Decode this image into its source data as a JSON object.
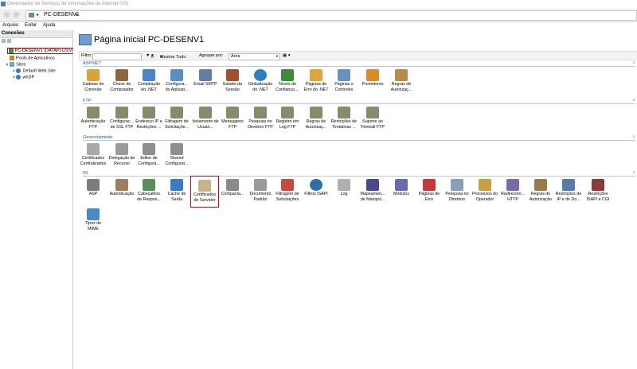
{
  "window": {
    "title": "Gerenciador de Serviços de Informações da Internet (IIS)"
  },
  "address": {
    "breadcrumb": "PC-DESENV1"
  },
  "menu": [
    "Arquivo",
    "Exibir",
    "Ajuda"
  ],
  "connections": {
    "header": "Conexões",
    "tree": [
      {
        "label": "PC-DESENV1 (DATAPLUS\\Vin",
        "level": 0,
        "selected": true
      },
      {
        "label": "Pools de Aplicativos",
        "level": 1
      },
      {
        "label": "Sites",
        "level": 1
      },
      {
        "label": "Default Web Site",
        "level": 2
      },
      {
        "label": "whDP",
        "level": 2
      }
    ]
  },
  "main": {
    "title": "Página inicial PC-DESENV1",
    "filter": {
      "label": "Filtro:",
      "go": "Ir",
      "show_all": "Mostrar Tudo",
      "group_label": "Agrupar por:",
      "group_value": "Área"
    },
    "sections": [
      {
        "name": "ASP.NET",
        "items": [
          {
            "label": "Cadeias de Conexão",
            "icon": "database-icon",
            "color": "#d9a437"
          },
          {
            "label": "Chave do Computador",
            "icon": "key-icon",
            "color": "#8b6a3a"
          },
          {
            "label": "Compilação do .NET",
            "icon": "compile-icon",
            "color": "#4a86c5"
          },
          {
            "label": "Configura... do Aplicati...",
            "icon": "app-settings-icon",
            "color": "#5a8fc3"
          },
          {
            "label": "Email SMTP",
            "icon": "email-icon",
            "color": "#5f7fa6"
          },
          {
            "label": "Estado da Sessão",
            "icon": "session-icon",
            "color": "#a0522d"
          },
          {
            "label": "Globalização do .NET",
            "icon": "globe-icon",
            "color": "#2f7fbf"
          },
          {
            "label": "Níveis de Confiança ...",
            "icon": "trust-icon",
            "color": "#3b8d3b"
          },
          {
            "label": "Páginas de Erro do .NET",
            "icon": "error-page-icon",
            "color": "#e0a43a"
          },
          {
            "label": "Páginas e Controles",
            "icon": "pages-icon",
            "color": "#6a8fc1"
          },
          {
            "label": "Provedores",
            "icon": "providers-icon",
            "color": "#d98c2b"
          },
          {
            "label": "Regras de Autorizaç...",
            "icon": "auth-rules-icon",
            "color": "#b88a4a"
          }
        ]
      },
      {
        "name": "FTP",
        "items": [
          {
            "label": "Autenticação FTP",
            "icon": "ftp-auth-icon",
            "color": "#8a8a6a"
          },
          {
            "label": "Configurac... de SSL FTP",
            "icon": "ftp-ssl-icon",
            "color": "#8a8a6a"
          },
          {
            "label": "Endereço IP e Restrições ...",
            "icon": "ftp-ip-icon",
            "color": "#8a8a6a"
          },
          {
            "label": "Filtragem de Solicitaçõe...",
            "icon": "ftp-filter-icon",
            "color": "#8a8a6a"
          },
          {
            "label": "Isolamento de Usuári...",
            "icon": "ftp-isolation-icon",
            "color": "#8a8a6a"
          },
          {
            "label": "Mensagens FTP",
            "icon": "ftp-messages-icon",
            "color": "#8a8a6a"
          },
          {
            "label": "Pesquisa no Diretório FTP",
            "icon": "ftp-dir-icon",
            "color": "#8a8a6a"
          },
          {
            "label": "Registro em Log FTP",
            "icon": "ftp-log-icon",
            "color": "#8a8a6a"
          },
          {
            "label": "Regras de Autorizaç...",
            "icon": "ftp-auth-rules-icon",
            "color": "#8a8a6a"
          },
          {
            "label": "Restrições de Tentativas ...",
            "icon": "ftp-logon-icon",
            "color": "#8a8a6a"
          },
          {
            "label": "Suporte ao Firewall FTP",
            "icon": "ftp-firewall-icon",
            "color": "#8a8a6a"
          }
        ]
      },
      {
        "name": "Gerenciamento",
        "items": [
          {
            "label": "Certificados Centralizados",
            "icon": "central-cert-icon",
            "color": "#a8a8a8"
          },
          {
            "label": "Delegação de Recurso",
            "icon": "delegation-icon",
            "color": "#9a9a9a"
          },
          {
            "label": "Editor de Configura...",
            "icon": "config-editor-icon",
            "color": "#8f8f8f"
          },
          {
            "label": "Shared Configurat...",
            "icon": "shared-config-icon",
            "color": "#8f8f8f"
          }
        ]
      },
      {
        "name": "IIS",
        "items": [
          {
            "label": "ASP",
            "icon": "asp-icon",
            "color": "#7d7d7d"
          },
          {
            "label": "Autenticação",
            "icon": "auth-icon",
            "color": "#9d7d5a"
          },
          {
            "label": "Cabeçalhos de Respos...",
            "icon": "headers-icon",
            "color": "#5a8e5a"
          },
          {
            "label": "Cache de Saída",
            "icon": "output-cache-icon",
            "color": "#3b7bbf"
          },
          {
            "label": "Certificados de Servidor",
            "icon": "server-cert-icon",
            "color": "#c7b38a",
            "selected": true
          },
          {
            "label": "Compacta...",
            "icon": "compression-icon",
            "color": "#8a8a8a"
          },
          {
            "label": "Documento Padrão",
            "icon": "default-doc-icon",
            "color": "#9a9a9a"
          },
          {
            "label": "Filtragem de Solicitações",
            "icon": "request-filter-icon",
            "color": "#c84a3a"
          },
          {
            "label": "Filtros ISAPI",
            "icon": "isapi-filter-icon",
            "color": "#2f6fa8"
          },
          {
            "label": "Log",
            "icon": "log-icon",
            "color": "#b0b0b0"
          },
          {
            "label": "Mapeamen... de Manipul...",
            "icon": "handler-icon",
            "color": "#4a4a8a"
          },
          {
            "label": "Módulos",
            "icon": "modules-icon",
            "color": "#6a6ab0"
          },
          {
            "label": "Páginas de Erro",
            "icon": "error-pages-icon",
            "color": "#c43a3a"
          },
          {
            "label": "Pesquisa no Diretório",
            "icon": "dir-browse-icon",
            "color": "#8aa0b8"
          },
          {
            "label": "Processos do Operador",
            "icon": "worker-icon",
            "color": "#c7a040"
          },
          {
            "label": "Redirecion... HTTP",
            "icon": "redirect-icon",
            "color": "#7a6aa8"
          },
          {
            "label": "Regras de Autorização",
            "icon": "iis-auth-rules-icon",
            "color": "#9a7a4a"
          },
          {
            "label": "Restrições de IP e de Do...",
            "icon": "ip-restrict-icon",
            "color": "#5a7aa8"
          },
          {
            "label": "Restrições ISAPI e CGI",
            "icon": "isapi-cgi-icon",
            "color": "#8a3a3a"
          },
          {
            "label": "Tipos de MIME",
            "icon": "mime-icon",
            "color": "#4a8ac0"
          }
        ]
      }
    ]
  }
}
